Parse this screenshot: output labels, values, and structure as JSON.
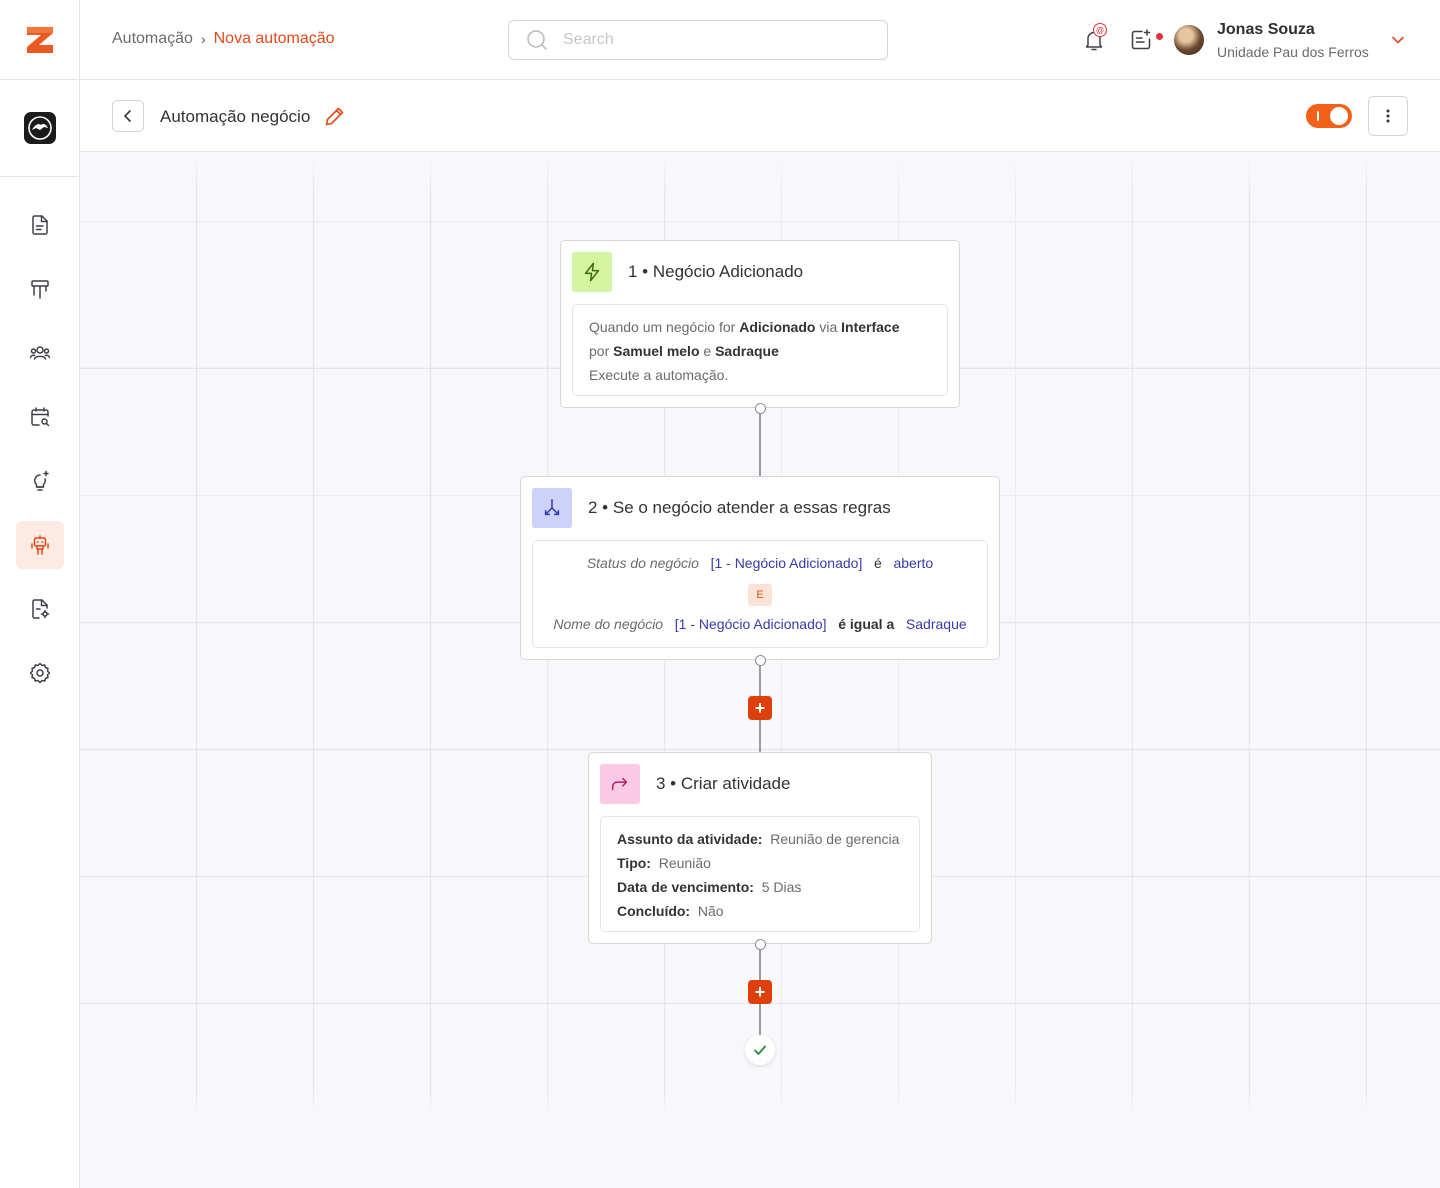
{
  "colors": {
    "accent": "#e3491b",
    "toggle": "#f36018",
    "plus": "#df3f0b"
  },
  "breadcrumb": {
    "root": "Automação",
    "separator": "›",
    "current": "Nova automação"
  },
  "search": {
    "placeholder": "Search",
    "value": ""
  },
  "user": {
    "name": "Jonas Souza",
    "unit": "Unidade Pau dos Ferros"
  },
  "sidebar": {
    "items": [
      {
        "name": "document-icon"
      },
      {
        "name": "pipeline-icon"
      },
      {
        "name": "contacts-icon"
      },
      {
        "name": "calendar-search-icon"
      },
      {
        "name": "lightbulb-icon"
      },
      {
        "name": "robot-icon",
        "active": true
      },
      {
        "name": "report-settings-icon"
      },
      {
        "name": "gear-icon"
      }
    ]
  },
  "automation": {
    "title": "Automação negócio",
    "enabled": true
  },
  "flow": {
    "trigger": {
      "title": "1 • Negócio Adicionado",
      "l1_a": "Quando um negócio for ",
      "l1_b": "Adicionado",
      "l1_c": " via ",
      "l1_d": "Interface",
      "l2_a": "por ",
      "l2_b": "Samuel melo",
      "l2_c": " e ",
      "l2_d": "Sadraque",
      "l3": "Execute a automação."
    },
    "condition": {
      "title": "2 • Se o negócio atender a essas regras",
      "rule1": {
        "field": "Status do negócio",
        "ref": "[1 - Negócio Adicionado]",
        "op": "é",
        "value": "aberto"
      },
      "joiner": "E",
      "rule2": {
        "field": "Nome do negócio",
        "ref": "[1 - Negócio Adicionado]",
        "op": "é igual a",
        "value": "Sadraque"
      }
    },
    "action": {
      "title": "3 • Criar atividade",
      "subject_label": "Assunto da atividade:",
      "subject_value": "Reunião de gerencia",
      "type_label": "Tipo:",
      "type_value": "Reunião",
      "due_label": "Data de vencimento:",
      "due_value": "5 Dias",
      "done_label": "Concluído:",
      "done_value": "Não"
    },
    "add_step_label": "+"
  }
}
